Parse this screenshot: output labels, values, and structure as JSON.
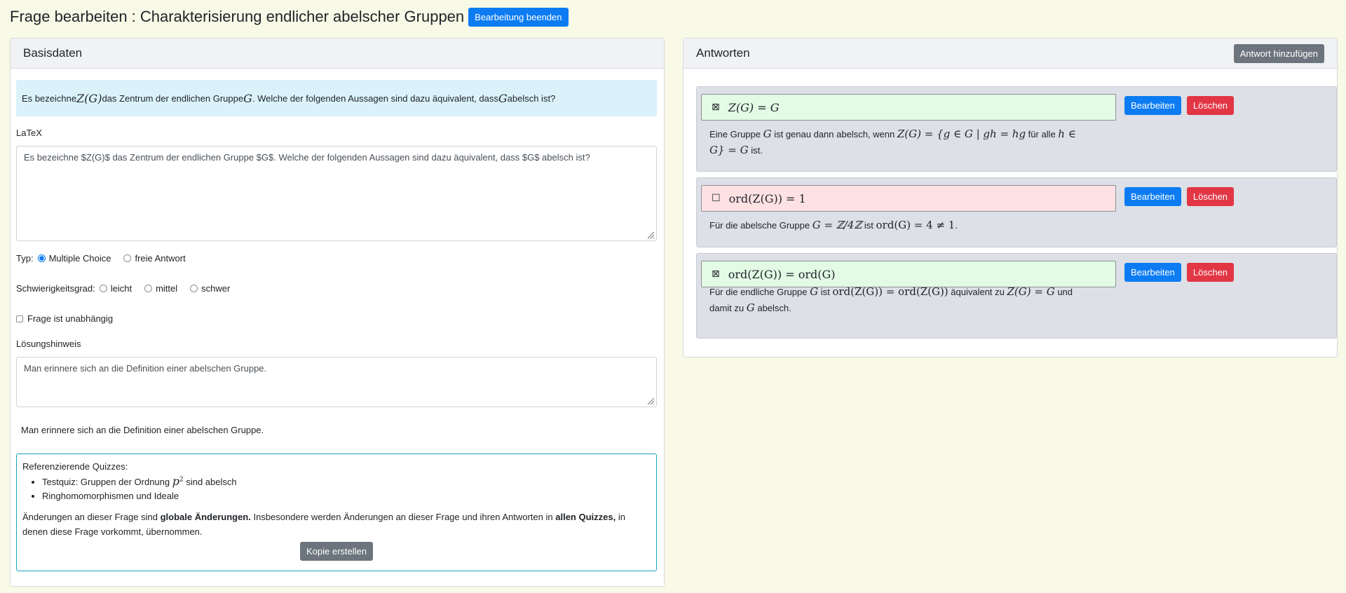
{
  "header": {
    "title": "Frage bearbeiten : Charakterisierung endlicher abelscher Gruppen",
    "end_button": "Bearbeitung beenden"
  },
  "basis": {
    "title": "Basisdaten",
    "question_rendered": {
      "t1": "Es bezeichne ",
      "m1": "Z(G)",
      "t2": " das Zentrum der endlichen Gruppe ",
      "m2": "G",
      "t3": ". Welche der folgenden Aussagen sind dazu äquivalent, dass ",
      "m3": "G",
      "t4": " abelsch ist?"
    },
    "latex_label": "LaTeX",
    "latex_value": "Es bezeichne $Z(G)$ das Zentrum der endlichen Gruppe $G$. Welche der folgenden Aussagen sind dazu äquivalent, dass $G$ abelsch ist?",
    "type_label": "Typ:",
    "type_options": [
      "Multiple Choice",
      "freie Antwort"
    ],
    "type_selected": "Multiple Choice",
    "difficulty_label": "Schwierigkeitsgrad:",
    "difficulty_options": [
      "leicht",
      "mittel",
      "schwer"
    ],
    "independent_label": "Frage ist unabhängig",
    "hint_label": "Lösungshinweis",
    "hint_value": "Man erinnere sich an die Definition einer abelschen Gruppe.",
    "hint_rendered": "Man erinnere sich an die Definition einer abelschen Gruppe.",
    "refs": {
      "title": "Referenzierende Quizzes:",
      "quiz1_prefix": "Testquiz: Gruppen der Ordnung ",
      "quiz1_math": "p",
      "quiz1_exp": "2",
      "quiz1_suffix": " sind abelsch",
      "quiz2": "Ringhomomorphismen und Ideale",
      "note_a": "Änderungen an dieser Frage sind ",
      "note_b": "globale Änderungen.",
      "note_c": " Insbesondere werden Änderungen an dieser Frage und ihren Antworten in ",
      "note_d": "allen Quizzes,",
      "note_e": " in denen diese Frage vorkommt, übernommen.",
      "copy_button": "Kopie erstellen"
    }
  },
  "answers": {
    "title": "Antworten",
    "add_button": "Antwort hinzufügen",
    "edit_label": "Bearbeiten",
    "delete_label": "Löschen",
    "items": [
      {
        "mark": "⊠",
        "correct": true,
        "formula": "Z(G) = G",
        "exp_a": "Eine Gruppe ",
        "exp_m1": "G",
        "exp_b": " ist genau dann abelsch, wenn ",
        "exp_m2": "Z(G) = {g ∈ G | gh = hg",
        "exp_c": " für alle ",
        "exp_m3": "h ∈",
        "exp_m4": "G} = G",
        "exp_d": " ist."
      },
      {
        "mark": "☐",
        "correct": false,
        "formula": "ord(Z(G)) = 1",
        "exp_a": "Für die abelsche Gruppe ",
        "exp_m1": "G = ℤ/4ℤ",
        "exp_b": " ist ",
        "exp_m2": "ord(G) = 4 ≠ 1",
        "exp_c": "."
      },
      {
        "mark": "⊠",
        "correct": true,
        "formula": "ord(Z(G)) = ord(G)",
        "exp_a": "Für die endliche Gruppe ",
        "exp_m1": "G",
        "exp_b": " ist ",
        "exp_m2": "ord(Z(G)) = ord(Z(G))",
        "exp_c": " äquivalent zu ",
        "exp_m3": "Z(G) = G",
        "exp_d": " und",
        "exp_e": "damit zu ",
        "exp_m4": "G",
        "exp_f": " abelsch."
      }
    ]
  }
}
